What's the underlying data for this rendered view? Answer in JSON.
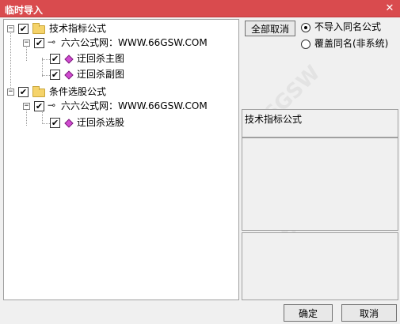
{
  "window": {
    "title": "临时导入",
    "close_glyph": "✕"
  },
  "tree": {
    "nodes": [
      {
        "label": "技术指标公式",
        "expander": "−",
        "checked": "✔"
      },
      {
        "label": "六六公式网：WWW.66GSW.COM",
        "expander": "−",
        "checked": "✔"
      },
      {
        "label": "迂回杀主图",
        "checked": "✔"
      },
      {
        "label": "迂回杀副图",
        "checked": "✔"
      },
      {
        "label": "条件选股公式",
        "expander": "−",
        "checked": "✔"
      },
      {
        "label": "六六公式网：WWW.66GSW.COM",
        "expander": "−",
        "checked": "✔"
      },
      {
        "label": "迂回杀选股",
        "checked": "✔"
      }
    ]
  },
  "controls": {
    "deselect_all": "全部取消",
    "radio_no_import": "不导入同名公式",
    "radio_overwrite": "覆盖同名(非系统)"
  },
  "info": {
    "category": "技术指标公式"
  },
  "footer": {
    "ok": "确定",
    "cancel": "取消"
  }
}
